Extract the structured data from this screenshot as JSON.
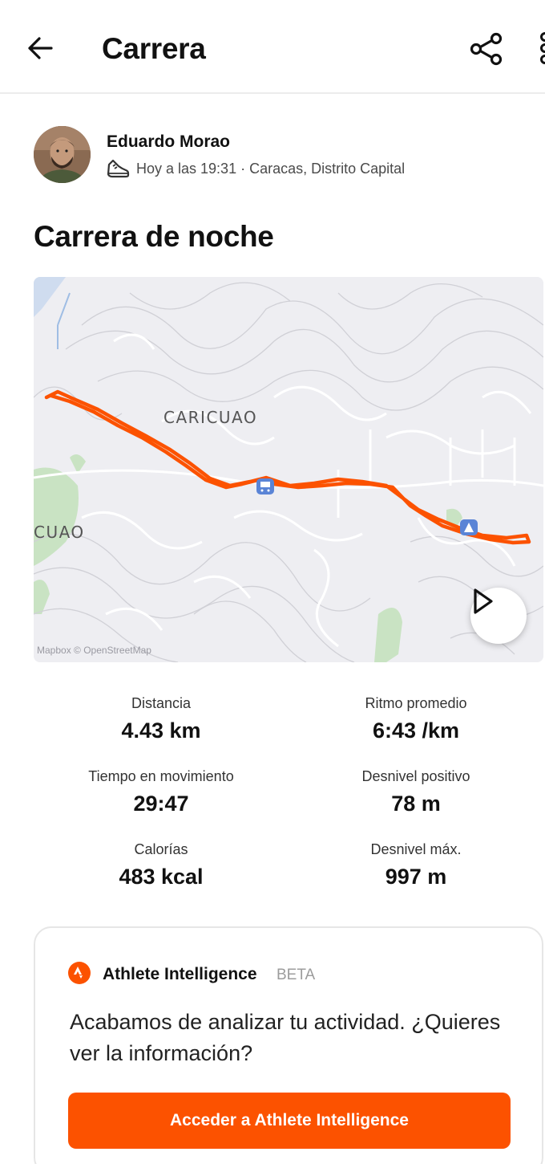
{
  "header": {
    "title": "Carrera",
    "icons": {
      "back": "arrow-left-icon",
      "share": "share-icon",
      "more": "more-vertical-icon"
    }
  },
  "athlete": {
    "name": "Eduardo Morao",
    "meta": "Hoy a las 19:31 · Caracas, Distrito Capital",
    "activity_icon": "running-shoe-icon"
  },
  "activity": {
    "title": "Carrera de noche"
  },
  "map": {
    "labels": {
      "area_main": "CARICUAO",
      "area_partial": "CUAO"
    },
    "attribution": "Mapbox © OpenStreetMap",
    "route_color": "#fc5200",
    "play_icon": "play-icon"
  },
  "stats": [
    {
      "label": "Distancia",
      "value": "4.43 km"
    },
    {
      "label": "Ritmo promedio",
      "value": "6:43 /km"
    },
    {
      "label": "Tiempo en movimiento",
      "value": "29:47"
    },
    {
      "label": "Desnivel positivo",
      "value": "78 m"
    },
    {
      "label": "Calorías",
      "value": "483 kcal"
    },
    {
      "label": "Desnivel máx.",
      "value": "997 m"
    }
  ],
  "athlete_intelligence": {
    "title": "Athlete Intelligence",
    "badge": "BETA",
    "message": "Acabamos de analizar tu actividad. ¿Quieres ver la información?",
    "button_label": "Acceder a Athlete Intelligence",
    "icon": "strava-logo-icon"
  },
  "colors": {
    "brand": "#fc5200",
    "divider": "#ececec",
    "muted": "#9c9c9c"
  }
}
